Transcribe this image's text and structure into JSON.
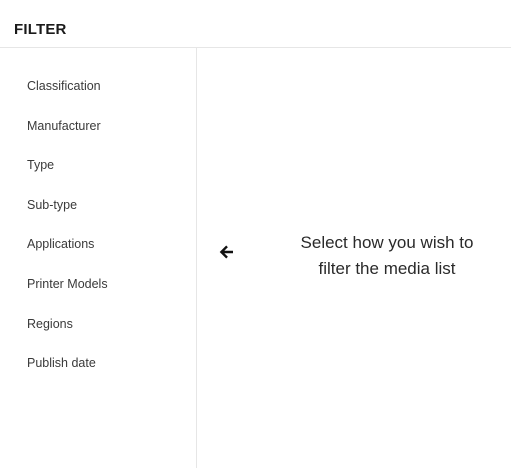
{
  "header": {
    "title": "FILTER"
  },
  "sidebar": {
    "items": [
      {
        "label": "Classification"
      },
      {
        "label": "Manufacturer"
      },
      {
        "label": "Type"
      },
      {
        "label": "Sub-type"
      },
      {
        "label": "Applications"
      },
      {
        "label": "Printer Models"
      },
      {
        "label": "Regions"
      },
      {
        "label": "Publish date"
      }
    ]
  },
  "main": {
    "arrow_icon": "arrow-left-icon",
    "hint_line1": "Select how you wish to",
    "hint_line2": "filter the media list"
  },
  "colors": {
    "text": "#222222",
    "divider": "#e6e6e6",
    "background": "#ffffff"
  }
}
